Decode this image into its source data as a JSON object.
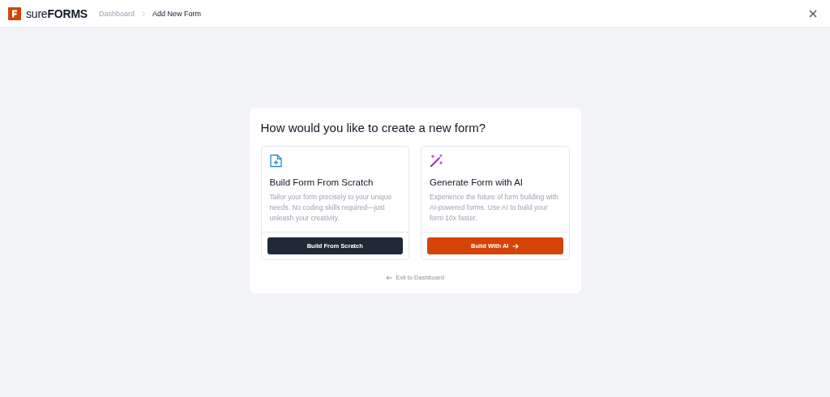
{
  "header": {
    "brand": "sure**FORMS**",
    "breadcrumbs": [
      {
        "label": "Dashboard",
        "selected": false
      },
      {
        "label": "Add New Form",
        "selected": true
      }
    ]
  },
  "dialog": {
    "title": "How would you like to create a new form?",
    "options": [
      {
        "kind": "scratch",
        "title": "Build Form From Scratch",
        "description": "Tailor your form precisely to your unique needs. No coding skills required—just unleash your creativity.",
        "button": "Build From Scratch"
      },
      {
        "kind": "ai",
        "title": "Generate Form with AI",
        "description": "Experience the future of form building with AI-powered forms. Use AI to build your form 10x faster.",
        "button": "Build With AI"
      }
    ],
    "exit_link": "Exit to Dashboard"
  }
}
